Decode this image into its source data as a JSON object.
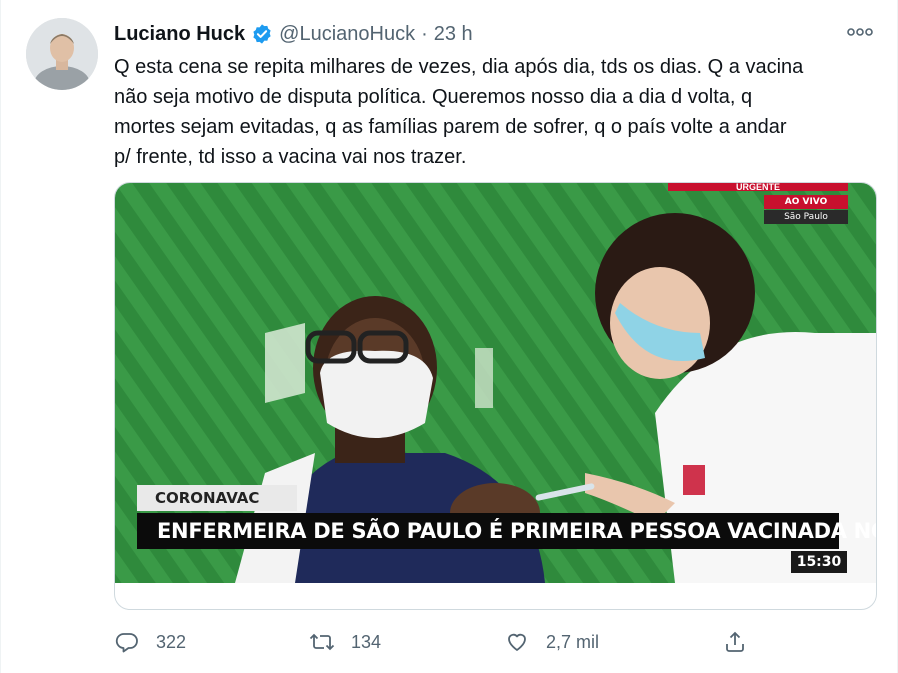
{
  "tweet": {
    "author": {
      "display_name": "Luciano Huck",
      "handle": "@LucianoHuck",
      "verified": true
    },
    "separator": "·",
    "timestamp": "23 h",
    "text_lines": [
      "Q esta cena se repita milhares de vezes, dia após dia, tds os dias. Q a vacina",
      "não seja motivo de disputa política. Queremos nosso dia a dia d volta, q",
      "mortes sejam evitadas, q as famílias parem de sofrer, q o país volte a andar",
      "p/ frente, td isso a vacina vai nos trazer."
    ],
    "media": {
      "broadcast": {
        "urgent_label": "URGENTE",
        "live_label": "AO VIVO",
        "city_label": "São Paulo",
        "tag": "CORONAVAC",
        "headline": "ENFERMEIRA DE SÃO PAULO É PRIMEIRA PESSOA VACINADA NO BRASIL",
        "clock": "15:30"
      }
    },
    "actions": {
      "replies": "322",
      "retweets": "134",
      "likes": "2,7 mil"
    }
  },
  "colors": {
    "verified_blue": "#1d9bf0",
    "secondary_text": "#536471",
    "primary_text": "#0f1419",
    "border": "#cfd9de",
    "broadcast_red": "#c8102e",
    "background_green": "#2f8a3c"
  },
  "icons": {
    "more": "more-horizontal-icon",
    "reply": "reply-icon",
    "retweet": "retweet-icon",
    "like": "heart-icon",
    "share": "share-icon",
    "verified": "verified-badge-icon"
  }
}
